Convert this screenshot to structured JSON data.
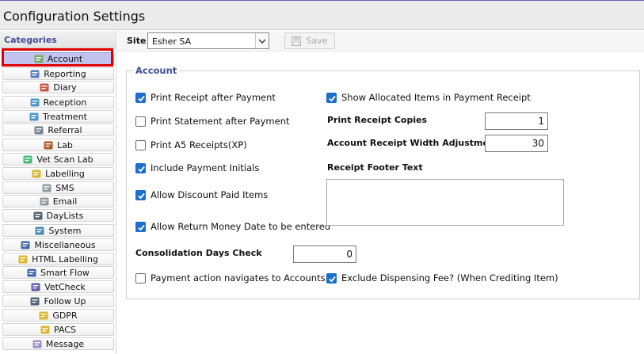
{
  "window": {
    "title": "Configuration Settings"
  },
  "sidebar": {
    "header": "Categories",
    "items": [
      {
        "label": "Account",
        "icon": "account-icon",
        "selected": true
      },
      {
        "label": "Reporting",
        "icon": "reporting-icon"
      },
      {
        "label": "Diary",
        "icon": "diary-icon"
      },
      {
        "label": "Reception",
        "icon": "reception-icon"
      },
      {
        "label": "Treatment",
        "icon": "treatment-icon"
      },
      {
        "label": "Referral",
        "icon": "referral-icon"
      },
      {
        "label": "Lab",
        "icon": "lab-icon"
      },
      {
        "label": "Vet Scan Lab",
        "icon": "vet-scan-lab-icon"
      },
      {
        "label": "Labelling",
        "icon": "labelling-icon"
      },
      {
        "label": "SMS",
        "icon": "sms-icon"
      },
      {
        "label": "Email",
        "icon": "email-icon"
      },
      {
        "label": "DayLists",
        "icon": "daylists-icon"
      },
      {
        "label": "System",
        "icon": "system-icon"
      },
      {
        "label": "Miscellaneous",
        "icon": "miscellaneous-icon"
      },
      {
        "label": "HTML Labelling",
        "icon": "html-labelling-icon"
      },
      {
        "label": "Smart Flow",
        "icon": "smart-flow-icon"
      },
      {
        "label": "VetCheck",
        "icon": "vetcheck-icon"
      },
      {
        "label": "Follow Up",
        "icon": "follow-up-icon"
      },
      {
        "label": "GDPR",
        "icon": "gdpr-icon"
      },
      {
        "label": "PACS",
        "icon": "pacs-icon"
      },
      {
        "label": "Message",
        "icon": "message-icon"
      }
    ]
  },
  "toolbar": {
    "site_label": "Site",
    "site_value": "Esher SA",
    "save_label": "Save"
  },
  "account": {
    "legend": "Account",
    "print_receipt_after_payment": {
      "label": "Print Receipt after Payment",
      "checked": true
    },
    "print_statement_after_payment": {
      "label": "Print Statement after Payment",
      "checked": false
    },
    "print_a5_receipts": {
      "label": "Print A5 Receipts(XP)",
      "checked": false
    },
    "include_payment_initials": {
      "label": "Include Payment Initials",
      "checked": true
    },
    "allow_discount_paid_items": {
      "label": "Allow Discount Paid Items",
      "checked": true
    },
    "allow_return_money_date": {
      "label": "Allow Return Money Date to be entered",
      "checked": true
    },
    "consolidation_days_check": {
      "label": "Consolidation Days Check",
      "value": "0"
    },
    "payment_action_navigates": {
      "label": "Payment action navigates to Accounts",
      "checked": false
    },
    "show_allocated_items": {
      "label": "Show Allocated Items in Payment Receipt",
      "checked": true
    },
    "print_receipt_copies": {
      "label": "Print Receipt Copies",
      "value": "1"
    },
    "receipt_width_adjustment": {
      "label": "Account Receipt Width Adjustment",
      "value": "30"
    },
    "receipt_footer_text": {
      "label": "Receipt Footer Text",
      "value": ""
    },
    "exclude_dispensing_fee": {
      "label": "Exclude Dispensing Fee? (When Crediting Item)",
      "checked": true
    }
  },
  "colors": {
    "accent_heading": "#3f4e96",
    "checkbox_checked": "#1c6fce",
    "selected_item_bg": "#c2c2ee",
    "selection_frame": "#e00000"
  }
}
